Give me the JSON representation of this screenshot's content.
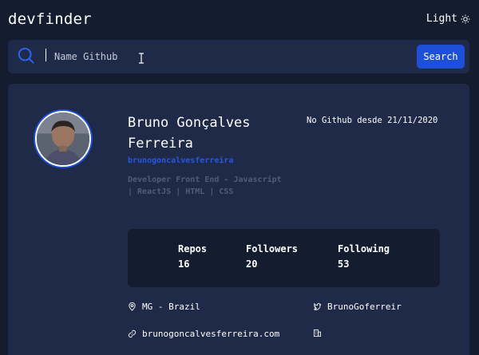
{
  "header": {
    "logo": "devfinder",
    "theme_label": "Light",
    "theme_icon": "sun-icon"
  },
  "search": {
    "placeholder": "Name Github",
    "value": "",
    "button_label": "Search",
    "icon": "search-icon"
  },
  "profile": {
    "name": "Bruno Gonçalves Ferreira",
    "username": "brunogoncalvesferreira",
    "joined": "No Github desde 21/11/2020",
    "bio": "Developer Front End - Javascript | ReactJS | HTML | CSS",
    "stats": [
      {
        "label": "Repos",
        "value": "16"
      },
      {
        "label": "Followers",
        "value": "20"
      },
      {
        "label": "Following",
        "value": "53"
      }
    ],
    "location": "MG - Brazil",
    "twitter": "BrunoGoferreir",
    "website": "brunogoncalvesferreira.com",
    "company": ""
  },
  "colors": {
    "background": "#141d2f",
    "card": "#1e2a47",
    "accent": "#1d4fd8",
    "muted": "#4f5d7a"
  }
}
